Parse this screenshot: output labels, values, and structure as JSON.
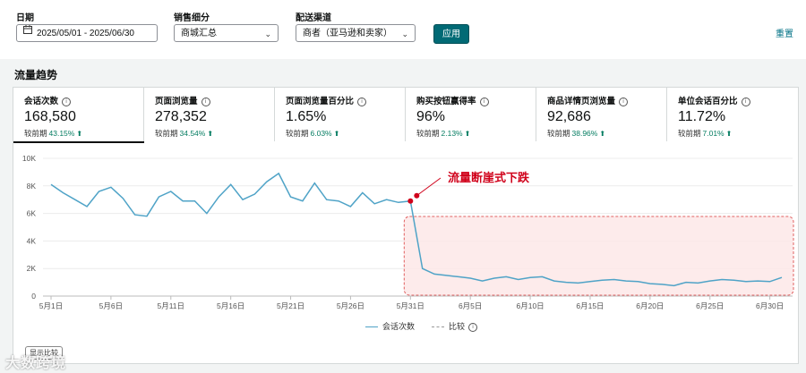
{
  "filters": {
    "date_label": "日期",
    "date_value": "2025/05/01 - 2025/06/30",
    "sales_label": "销售细分",
    "sales_value": "商城汇总",
    "channel_label": "配送渠道",
    "channel_value": "商者（亚马逊和卖家）",
    "apply_label": "应用",
    "reset_label": "重置"
  },
  "section_title": "流量趋势",
  "metrics": [
    {
      "label": "会话次数",
      "value": "168,580",
      "compare_label": "较前期",
      "change": "43.15%"
    },
    {
      "label": "页面浏览量",
      "value": "278,352",
      "compare_label": "较前期",
      "change": "34.54%"
    },
    {
      "label": "页面浏览量百分比",
      "value": "1.65%",
      "compare_label": "较前期",
      "change": "6.03%"
    },
    {
      "label": "购买按钮赢得率",
      "value": "96%",
      "compare_label": "较前期",
      "change": "2.13%"
    },
    {
      "label": "商品详情页浏览量",
      "value": "92,686",
      "compare_label": "较前期",
      "change": "38.96%"
    },
    {
      "label": "单位会话百分比",
      "value": "11.72%",
      "compare_label": "较前期",
      "change": "7.01%"
    }
  ],
  "chart_data": {
    "type": "line",
    "y_ticks": [
      "10K",
      "8K",
      "6K",
      "4K",
      "2K",
      "0"
    ],
    "ylim": [
      0,
      10000
    ],
    "x_ticks": [
      "5月1日",
      "5月6日",
      "5月11日",
      "5月16日",
      "5月21日",
      "5月26日",
      "5月31日",
      "6月5日",
      "6月10日",
      "6月15日",
      "6月20日",
      "6月25日",
      "6月30日"
    ],
    "grid": true,
    "series": [
      {
        "name": "会话次数",
        "color": "#4fa3c7",
        "values": [
          8100,
          7500,
          7000,
          6500,
          7600,
          7900,
          7100,
          5900,
          5800,
          7200,
          7600,
          6900,
          6900,
          6000,
          7200,
          8100,
          7000,
          7400,
          8300,
          8900,
          7200,
          6900,
          8200,
          7000,
          6900,
          6500,
          7500,
          6700,
          7000,
          6800,
          6900,
          2000,
          1600,
          1500,
          1400,
          1300,
          1100,
          1300,
          1400,
          1200,
          1350,
          1400,
          1100,
          1000,
          950,
          1050,
          1150,
          1200,
          1100,
          1050,
          900,
          850,
          750,
          1000,
          950,
          1100,
          1200,
          1150,
          1050,
          1100,
          1050,
          1350
        ]
      }
    ],
    "legend": [
      {
        "label": "会话次数",
        "style": "solid"
      },
      {
        "label": "比较",
        "style": "dashed"
      }
    ],
    "legend_position": "bottom",
    "annotation": {
      "text": "流量断崖式下跌",
      "color": "#d0021b"
    },
    "highlight_region_color": "#fde8e8"
  },
  "show_compare_label": "显示比较",
  "watermark": "大数跨境"
}
